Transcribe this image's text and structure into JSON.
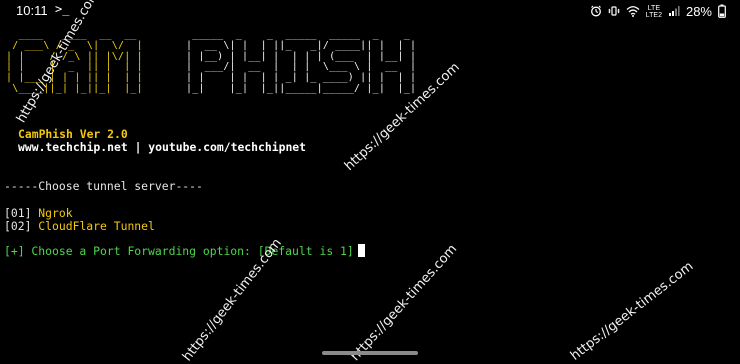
{
  "status_bar": {
    "time": "10:11",
    "terminal_glyph": ">_",
    "network_top": "Vo)",
    "network_type_top": "LTE",
    "network_type_bottom": "LTE2",
    "battery_percent": "28%",
    "icons": [
      "alarm-icon",
      "vibrate-icon",
      "wifi-icon",
      "network-lte-icon",
      "signal-icon",
      "battery-icon"
    ]
  },
  "terminal": {
    "banner_cam_lines": [
      "  ____   ____  __  __",
      " / ___\\ / _  \\|  \\/  |",
      "| |    / /_\\ || |\\/| |",
      "| |    |  _  || |  | |",
      "| |___ | | | || |  | |",
      " \\____||_| |_||_|  |_|"
    ],
    "banner_phish_lines": [
      " _____  _    _  _____  _____  _    _",
      "|  __ \\| |  | ||_   _|/ ____|| |  | |",
      "| |__) | |__| |  | | | (___  | |__| |",
      "|  ___/|  __  |  | |  \\___ \\ |  __  |",
      "| |    | |  | | _| |_ ____) || |  | |",
      "|_|    |_|  |_||_____|_____/ |_|  |_|"
    ],
    "version": "CamPhish Ver 2.0",
    "urls": "www.techchip.net | youtube.com/techchipnet",
    "choose_tunnel": "-----Choose tunnel server----",
    "options": [
      {
        "bracket": "[01]",
        "label": "Ngrok"
      },
      {
        "bracket": "[02]",
        "label": "CloudFlare Tunnel"
      }
    ],
    "port_prompt": "[+] Choose a Port Forwarding option: [Default is 1]"
  },
  "watermarks": [
    "https://geek-times.com",
    "https://geek-times.com",
    "https://geek-times.com",
    "https://geek-times.com",
    "https://geek-times.com"
  ],
  "colors": {
    "background": "#000000",
    "banner_yellow": "#f2d20a",
    "option_yellow": "#f2c80f",
    "prompt_green": "#4ed44e",
    "text_white": "#ffffff"
  }
}
